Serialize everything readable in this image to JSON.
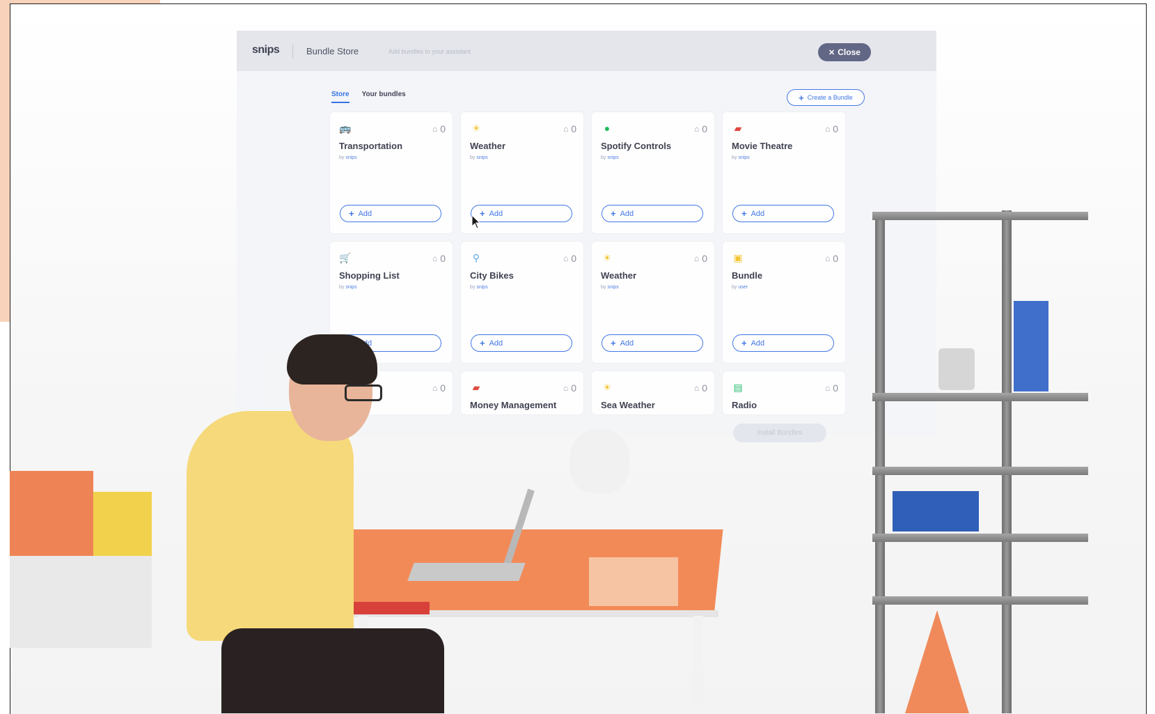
{
  "app": {
    "logo": "snips",
    "title": "Bundle Store",
    "subtitle": "Add bundles to your assistant",
    "close_label": "Close",
    "tabs": [
      {
        "label": "Store",
        "active": true
      },
      {
        "label": "Your bundles",
        "active": false
      }
    ],
    "create_label": "Create a Bundle",
    "install_label": "Install Bundles",
    "add_label": "Add",
    "accent": "#2f6fe4",
    "bundles": [
      {
        "name": "Transportation",
        "by": "by",
        "author": "snips",
        "count": "0",
        "icon": "bus-icon",
        "icon_color": "#e0453b"
      },
      {
        "name": "Weather",
        "by": "by",
        "author": "snips",
        "count": "0",
        "icon": "sun-icon",
        "icon_color": "#f2c42c"
      },
      {
        "name": "Spotify Controls",
        "by": "by",
        "author": "snips",
        "count": "0",
        "icon": "spotify-icon",
        "icon_color": "#1db954"
      },
      {
        "name": "Movie Theatre",
        "by": "by",
        "author": "snips",
        "count": "0",
        "icon": "camera-icon",
        "icon_color": "#e0453b"
      },
      {
        "name": "Shopping List",
        "by": "by",
        "author": "snips",
        "count": "0",
        "icon": "cart-icon",
        "icon_color": "#1db96b"
      },
      {
        "name": "City Bikes",
        "by": "by",
        "author": "snips",
        "count": "0",
        "icon": "bike-icon",
        "icon_color": "#5aa7e8"
      },
      {
        "name": "Weather",
        "by": "by",
        "author": "snips",
        "count": "0",
        "icon": "sun-icon",
        "icon_color": "#f2c42c"
      },
      {
        "name": "Bundle",
        "by": "by",
        "author": "user",
        "count": "0",
        "icon": "calendar-icon",
        "icon_color": "#f2c42c"
      },
      {
        "name": "",
        "by": "",
        "author": "",
        "count": "0",
        "icon": "",
        "icon_color": "#cccccc"
      },
      {
        "name": "Money Management",
        "by": "",
        "author": "",
        "count": "0",
        "icon": "wallet-icon",
        "icon_color": "#e0453b"
      },
      {
        "name": "Sea Weather",
        "by": "",
        "author": "",
        "count": "0",
        "icon": "sun-icon",
        "icon_color": "#f2c42c"
      },
      {
        "name": "Radio",
        "by": "",
        "author": "",
        "count": "0",
        "icon": "radio-icon",
        "icon_color": "#1db96b"
      }
    ]
  }
}
